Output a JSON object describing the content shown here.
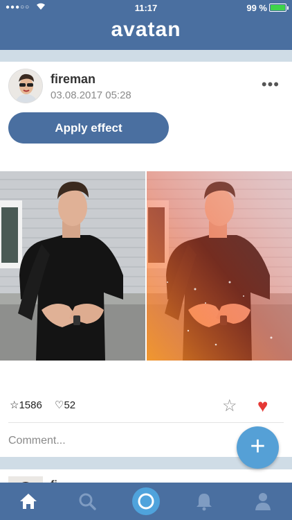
{
  "status_bar": {
    "signal": "●●●○○",
    "time": "11:17",
    "battery_text": "99 %"
  },
  "header": {
    "brand": "avatan"
  },
  "post": {
    "username": "fireman",
    "timestamp": "03.08.2017 05:28",
    "more_label": "•••",
    "apply_label": "Apply effect",
    "stars_count": "1586",
    "likes_count": "52",
    "comment_placeholder": "Comment...",
    "liked": true
  },
  "next_post": {
    "username": "fi"
  },
  "fab": {
    "label": "+"
  },
  "tabbar": {
    "items": [
      "home-tab",
      "search-tab",
      "camera-tab",
      "notifications-tab",
      "profile-tab"
    ],
    "active": "home-tab"
  },
  "colors": {
    "brand": "#4a6fa0",
    "accent": "#55a0d6",
    "heart": "#e53935",
    "background": "#cfdce6"
  }
}
